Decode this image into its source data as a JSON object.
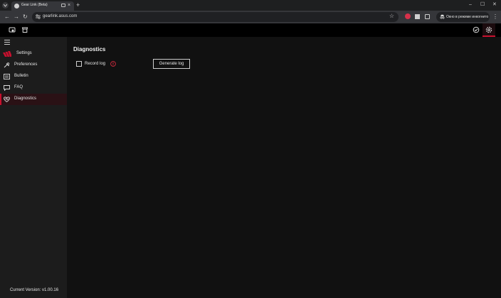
{
  "browser": {
    "tab_title": "Gear Link (Beta)",
    "tab_close": "×",
    "new_tab": "+",
    "url": "gearlink.asus.com",
    "incognito_label": "Окно в режиме инкогнито",
    "window_controls": {
      "minimize": "–",
      "maximize": "☐",
      "close": "✕"
    },
    "nav": {
      "back": "←",
      "forward": "→",
      "reload": "↻"
    },
    "star": "☆",
    "menu": "⋮"
  },
  "sidebar": {
    "brand_label": "Settings",
    "items": [
      {
        "label": "Preferences",
        "icon": "preferences-icon"
      },
      {
        "label": "Bulletin",
        "icon": "bulletin-icon"
      },
      {
        "label": "FAQ",
        "icon": "faq-icon"
      },
      {
        "label": "Diagnostics",
        "icon": "diagnostics-icon",
        "active": true
      }
    ],
    "version": "Current Version: v1.00.16"
  },
  "main": {
    "title": "Diagnostics",
    "record_log_label": "Record log",
    "record_log_checked": false,
    "generate_button": "Generate log"
  },
  "colors": {
    "accent": "#c8102e",
    "sidebar_bg": "#1c1c1c",
    "content_bg": "#111111",
    "header_bg": "#000000"
  }
}
